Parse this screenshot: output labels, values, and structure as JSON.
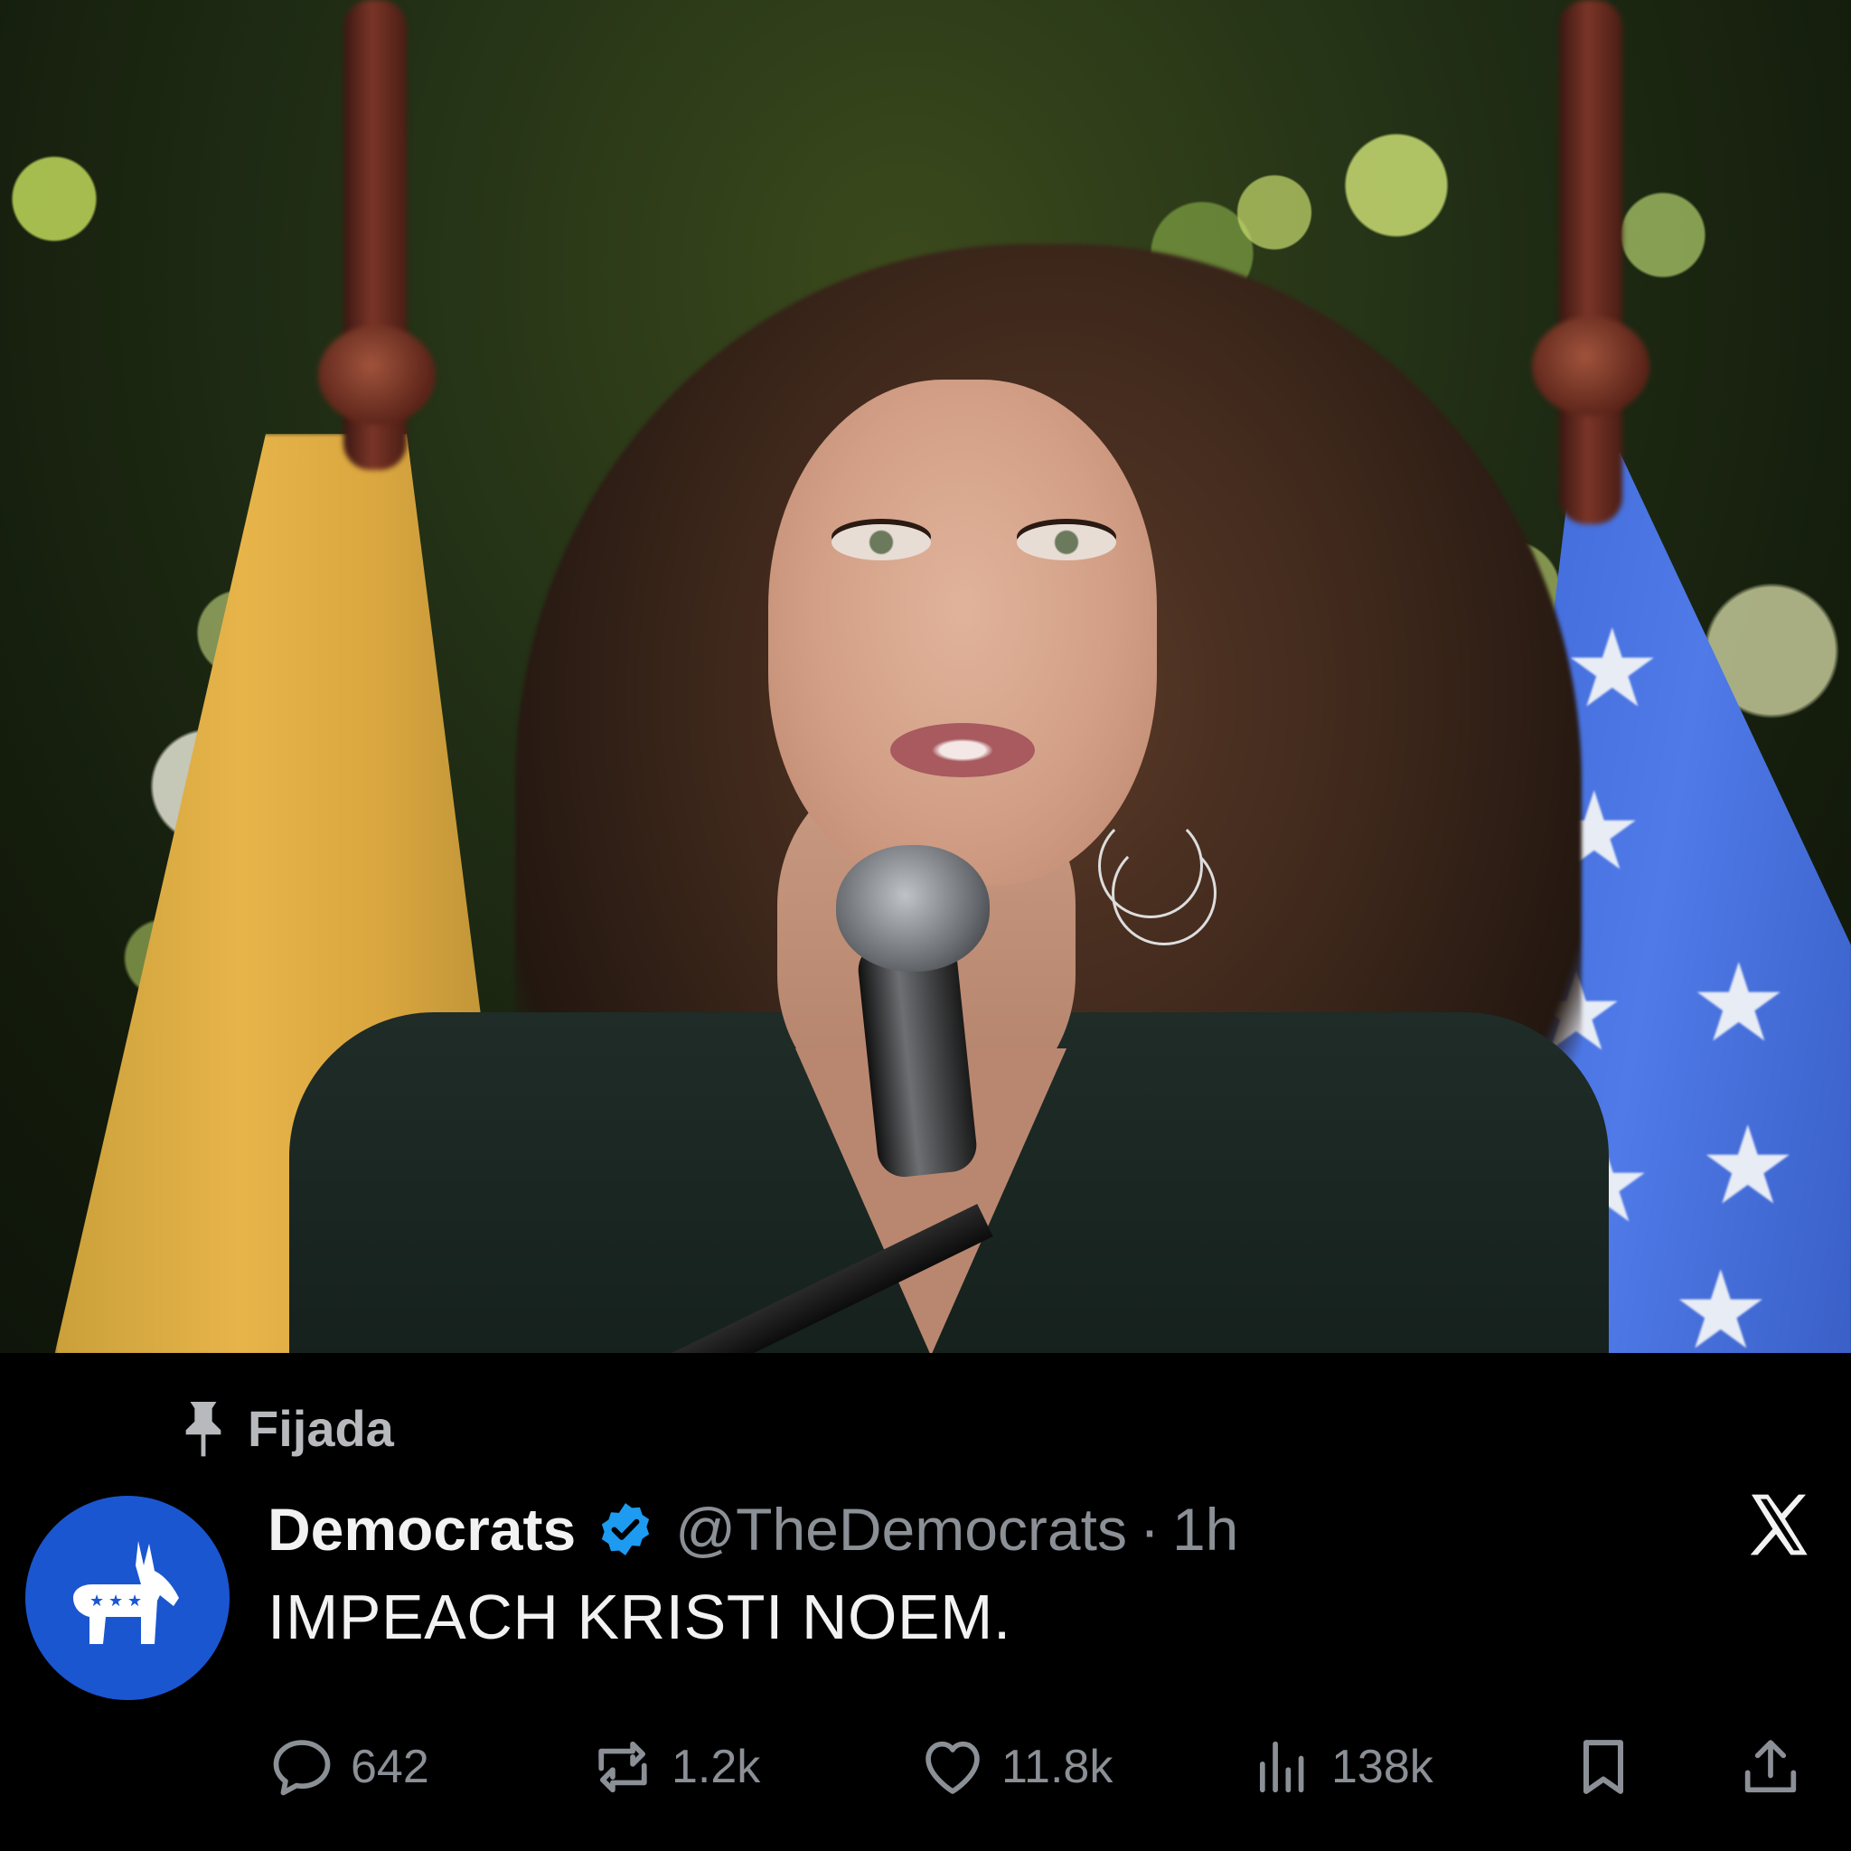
{
  "photo": {
    "alt": ""
  },
  "tweet": {
    "pinned_label": "Fijada",
    "author_name": "Democrats",
    "handle": "@TheDemocrats",
    "separator": "·",
    "time": "1h",
    "text": "IMPEACH KRISTI NOEM.",
    "stats": {
      "replies": "642",
      "reposts": "1.2k",
      "likes": "11.8k",
      "views": "138k"
    }
  },
  "colors": {
    "background": "#000000",
    "avatar": "#1b56d1",
    "verified": "#1d9bf0",
    "muted": "#8b9096"
  },
  "icons": [
    "pin-icon",
    "donkey-icon",
    "verified-badge-icon",
    "x-logo-icon",
    "reply-icon",
    "repost-icon",
    "like-icon",
    "views-icon",
    "bookmark-icon",
    "share-icon"
  ]
}
